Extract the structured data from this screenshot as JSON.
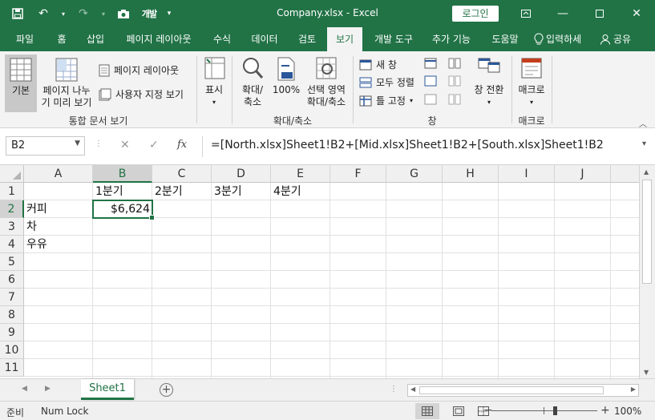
{
  "window": {
    "title": "Company.xlsx  -  Excel",
    "login_label": "로그인",
    "quick_access_text": "개발"
  },
  "tabs": [
    "파일",
    "홈",
    "삽입",
    "페이지 레이아웃",
    "수식",
    "데이터",
    "검토",
    "보기",
    "개발 도구",
    "추가 기능",
    "도움말"
  ],
  "active_tab": "보기",
  "tell_me": "입력하세",
  "share": "공유",
  "ribbon": {
    "normal": "기본",
    "page_break_line1": "페이지 나누",
    "page_break_line2": "기 미리 보기",
    "page_layout": "페이지 레이아웃",
    "custom_views": "사용자 지정 보기",
    "group_workbook_views": "통합 문서 보기",
    "show": "표시",
    "zoom_line1": "확대/",
    "zoom_line2": "축소",
    "zoom100": "100%",
    "zoom_sel_line1": "선택 영역",
    "zoom_sel_line2": "확대/축소",
    "group_zoom": "확대/축소",
    "new_window": "새 창",
    "arrange_all": "모두 정렬",
    "freeze_panes": "틀 고정",
    "group_window": "창",
    "switch_windows": "창 전환",
    "macros": "매크로",
    "group_macros": "매크로"
  },
  "formula_bar": {
    "name_box": "B2",
    "fx": "fx",
    "formula": "=[North.xlsx]Sheet1!B2+[Mid.xlsx]Sheet1!B2+[South.xlsx]Sheet1!B2"
  },
  "grid": {
    "columns": [
      "A",
      "B",
      "C",
      "D",
      "E",
      "F",
      "G",
      "H",
      "I",
      "J"
    ],
    "rows": [
      "1",
      "2",
      "3",
      "4",
      "5",
      "6",
      "7",
      "8",
      "9",
      "10",
      "11"
    ],
    "selected_cell": "B2",
    "cells": {
      "B1": "1분기",
      "C1": "2분기",
      "D1": "3분기",
      "E1": "4분기",
      "A2": "커피",
      "B2": "$6,624",
      "A3": "차",
      "A4": "우유"
    }
  },
  "sheets": [
    "Sheet1"
  ],
  "status": {
    "mode": "준비",
    "num_lock": "Num Lock",
    "zoom": "100%"
  }
}
